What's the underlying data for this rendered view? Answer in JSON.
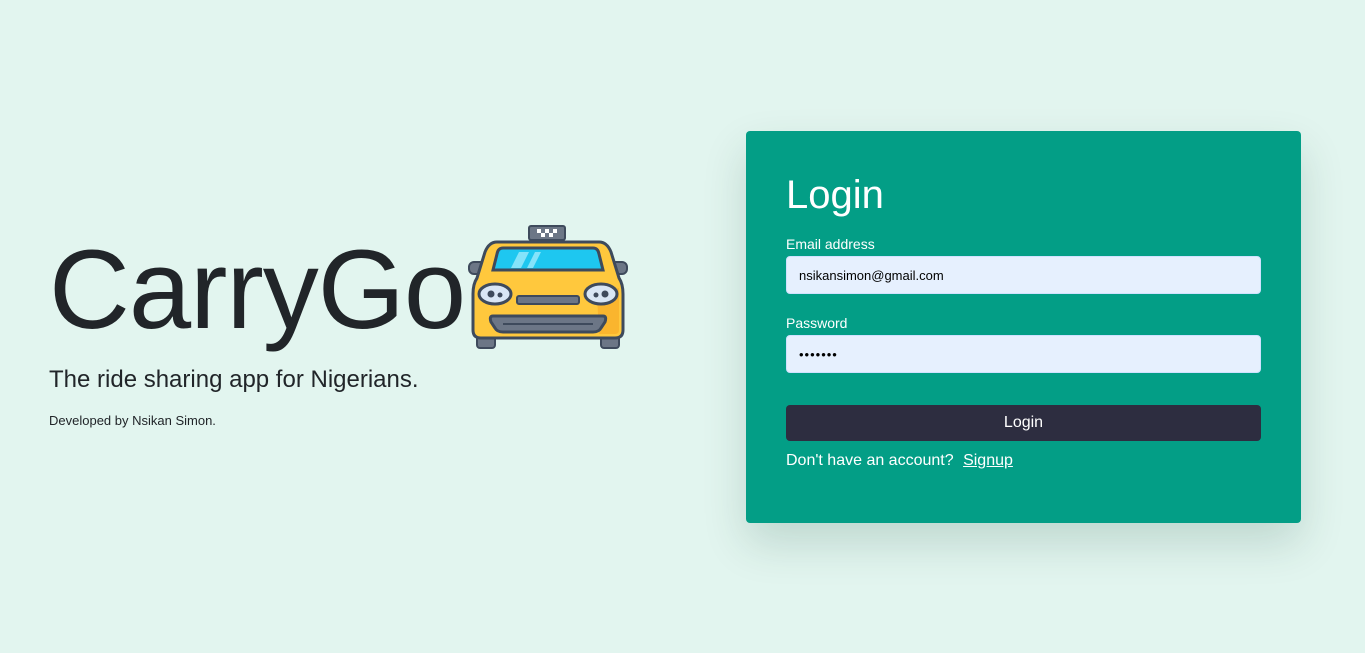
{
  "hero": {
    "brand": "CarryGo",
    "brand_icon": "taxi-icon",
    "tagline": "The ride sharing app for Nigerians.",
    "credit": "Developed by Nsikan Simon."
  },
  "login": {
    "title": "Login",
    "email_label": "Email address",
    "email_value": "nsikansimon@gmail.com",
    "password_label": "Password",
    "password_value": "•••••••",
    "button_label": "Login",
    "signup_prompt": "Don't have an account?",
    "signup_link": "Signup"
  },
  "colors": {
    "page_background": "#e2f5ef",
    "card_background": "#039e86",
    "input_background": "#e6f0fe",
    "button_background": "#2d2d40",
    "taxi_body": "#ffc83d",
    "taxi_outline": "#3e4a5c"
  }
}
